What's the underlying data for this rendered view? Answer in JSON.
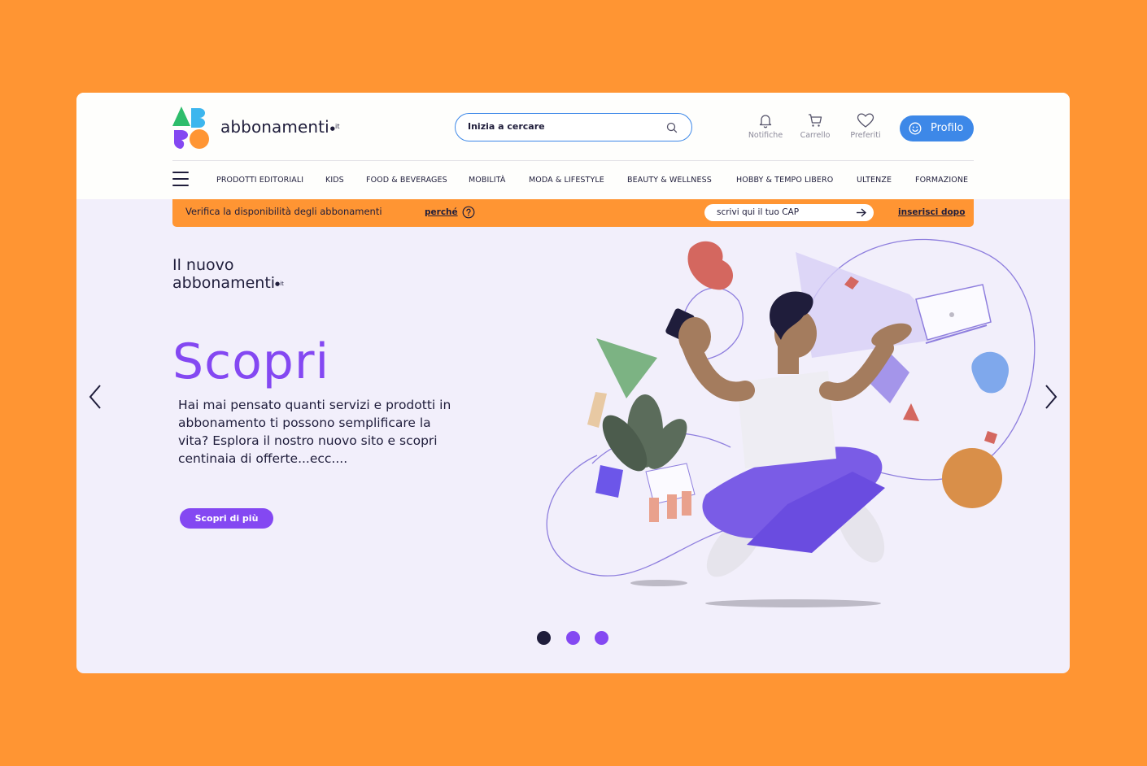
{
  "brand": {
    "name": "abbonamenti",
    "tld": "it"
  },
  "search": {
    "placeholder": "Inizia a cercare",
    "icon": "search-icon"
  },
  "header_actions": [
    {
      "label": "Notifiche",
      "icon": "bell-icon"
    },
    {
      "label": "Carrello",
      "icon": "cart-icon"
    },
    {
      "label": "Preferiti",
      "icon": "heart-icon"
    }
  ],
  "profile": {
    "label": "Profilo",
    "icon": "smiley-icon"
  },
  "nav": {
    "items": [
      "PRODOTTI EDITORIALI",
      "KIDS",
      "FOOD & BEVERAGES",
      "MOBILITÀ",
      "MODA & LIFESTYLE",
      "BEAUTY & WELLNESS",
      "HOBBY & TEMPO LIBERO",
      "ULTENZE",
      "FORMAZIONE"
    ]
  },
  "cap_banner": {
    "text": "Verifica la disponibilità degli abbonamenti",
    "why_label": "perché",
    "input_placeholder": "scrivi qui il tuo CAP",
    "later_label": "inserisci dopo"
  },
  "hero": {
    "kicker_line1": "Il nuovo",
    "kicker_line2": "abbonamenti",
    "kicker_tld": "it",
    "headline": "Scopri",
    "body": "Hai mai pensato quanti servizi e prodotti in abbonamento ti possono semplificare la vita? Esplora il nostro nuovo sito e scopri centinaia di offerte...ecc....",
    "cta": "Scopri di più"
  },
  "carousel": {
    "slides": 3,
    "active_slide": 1
  },
  "colors": {
    "page_bg": "#FF9533",
    "hero_bg": "#F2EFFB",
    "accent_purple": "#8448F2",
    "accent_blue": "#3D88E8",
    "text_dark": "#1F1D3B"
  }
}
